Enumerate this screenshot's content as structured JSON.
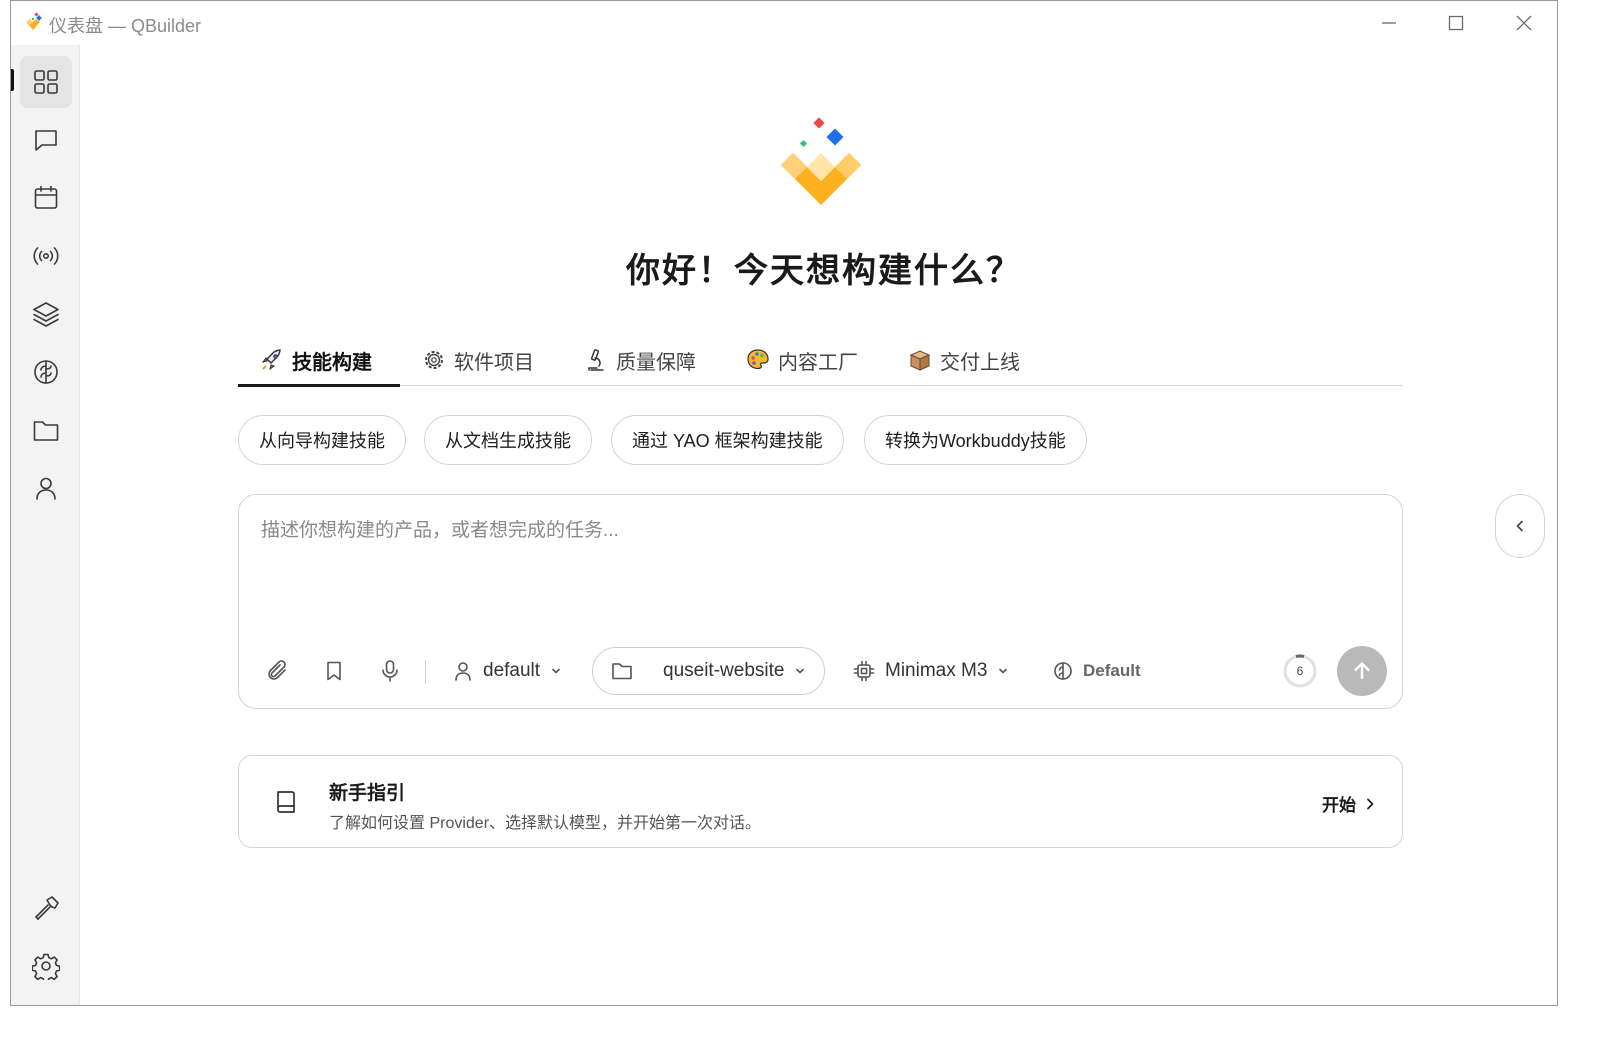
{
  "window": {
    "title": "仪表盘 — QBuilder"
  },
  "sidebar": {
    "items": [
      {
        "icon": "grid-icon",
        "active": true
      },
      {
        "icon": "chat-icon"
      },
      {
        "icon": "calendar-icon"
      },
      {
        "icon": "broadcast-icon"
      },
      {
        "icon": "layers-icon"
      },
      {
        "icon": "brain-icon"
      },
      {
        "icon": "folder-icon"
      },
      {
        "icon": "user-icon"
      }
    ],
    "bottom_items": [
      {
        "icon": "hammer-icon"
      },
      {
        "icon": "gear-icon"
      }
    ]
  },
  "main": {
    "greeting": "你好！今天想构建什么？",
    "tabs": [
      {
        "label": "技能构建",
        "icon": "rocket-icon",
        "active": true
      },
      {
        "label": "软件项目",
        "icon": "gear-icon"
      },
      {
        "label": "质量保障",
        "icon": "microscope-icon"
      },
      {
        "label": "内容工厂",
        "icon": "palette-icon"
      },
      {
        "label": "交付上线",
        "icon": "package-icon"
      }
    ],
    "chips": [
      "从向导构建技能",
      "从文档生成技能",
      "通过 YAO 框架构建技能",
      "转换为Workbuddy技能"
    ],
    "composer": {
      "placeholder": "描述你想构建的产品，或者想完成的任务...",
      "agent": "default",
      "project": "quseit-website",
      "model": "Minimax M3",
      "mode": "Default",
      "counter": "6"
    },
    "guide": {
      "title": "新手指引",
      "description": "了解如何设置 Provider、选择默认模型，并开始第一次对话。",
      "action": "开始"
    }
  },
  "colors": {
    "accent": "#1a1a1a",
    "logo_yellow": "#FFB020",
    "logo_red": "#F24A4A",
    "logo_blue": "#1E6FE8",
    "logo_green": "#2EC66B",
    "send_button": "#b9b9b9"
  }
}
